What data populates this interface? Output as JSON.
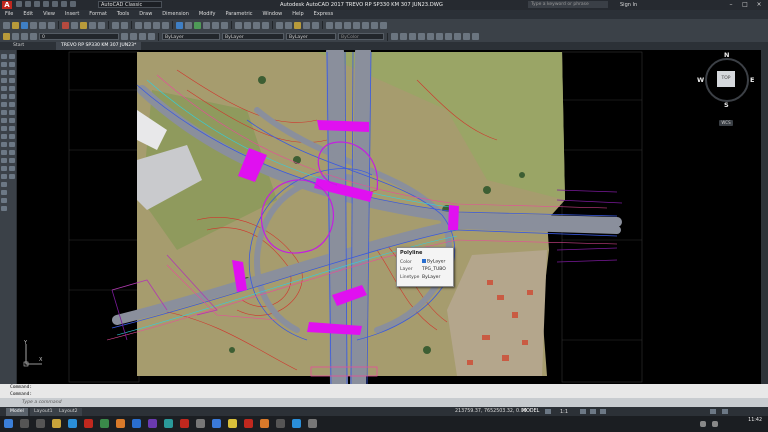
{
  "titlebar": {
    "logo": "A",
    "workspace": "AutoCAD Classic",
    "title": "Autodesk AutoCAD 2017   TREVO RP SP330 KM 307 JUN23.DWG",
    "search_placeholder": "Type a keyword or phrase",
    "sign_in": "Sign In"
  },
  "menu": [
    "File",
    "Edit",
    "View",
    "Insert",
    "Format",
    "Tools",
    "Draw",
    "Dimension",
    "Modify",
    "Parametric",
    "Window",
    "Help",
    "Express"
  ],
  "toolbar2": {
    "layer_value": "0",
    "color_value": "ByLayer",
    "linetype_value": "ByLayer",
    "lineweight_value": "ByLayer",
    "plotstyle_value": "ByColor"
  },
  "tabs": {
    "start": "Start",
    "file": "TREVO RP SP330 KM 307 JUN23*"
  },
  "viewcube": {
    "top": "TOP",
    "n": "N",
    "s": "S",
    "e": "E",
    "w": "W",
    "wcs": "WCS"
  },
  "ucs": {
    "x": "X",
    "y": "Y"
  },
  "tooltip": {
    "title": "Polyline",
    "rows": [
      {
        "key": "Color",
        "value": "ByLayer"
      },
      {
        "key": "Layer",
        "value": "TPG_TUBO"
      },
      {
        "key": "Linetype",
        "value": "ByLayer"
      }
    ],
    "swatch_color": "#2a6fd0"
  },
  "command": {
    "history1": "Command:",
    "history2": "Command:",
    "placeholder": "Type a command"
  },
  "layouts": [
    "Model",
    "Layout1",
    "Layout2"
  ],
  "status": {
    "coords": "213759.37, 7652503.32, 0.00",
    "mode": "MODEL",
    "scale": "1:1"
  },
  "clock": {
    "time": "11:42"
  },
  "colors": {
    "road_gray": "#8a8f9c",
    "magenta": "#e010f0",
    "contour_red": "#d0342c",
    "blue_line": "#3a5ae0",
    "cyan_line": "#2fd0e0"
  }
}
